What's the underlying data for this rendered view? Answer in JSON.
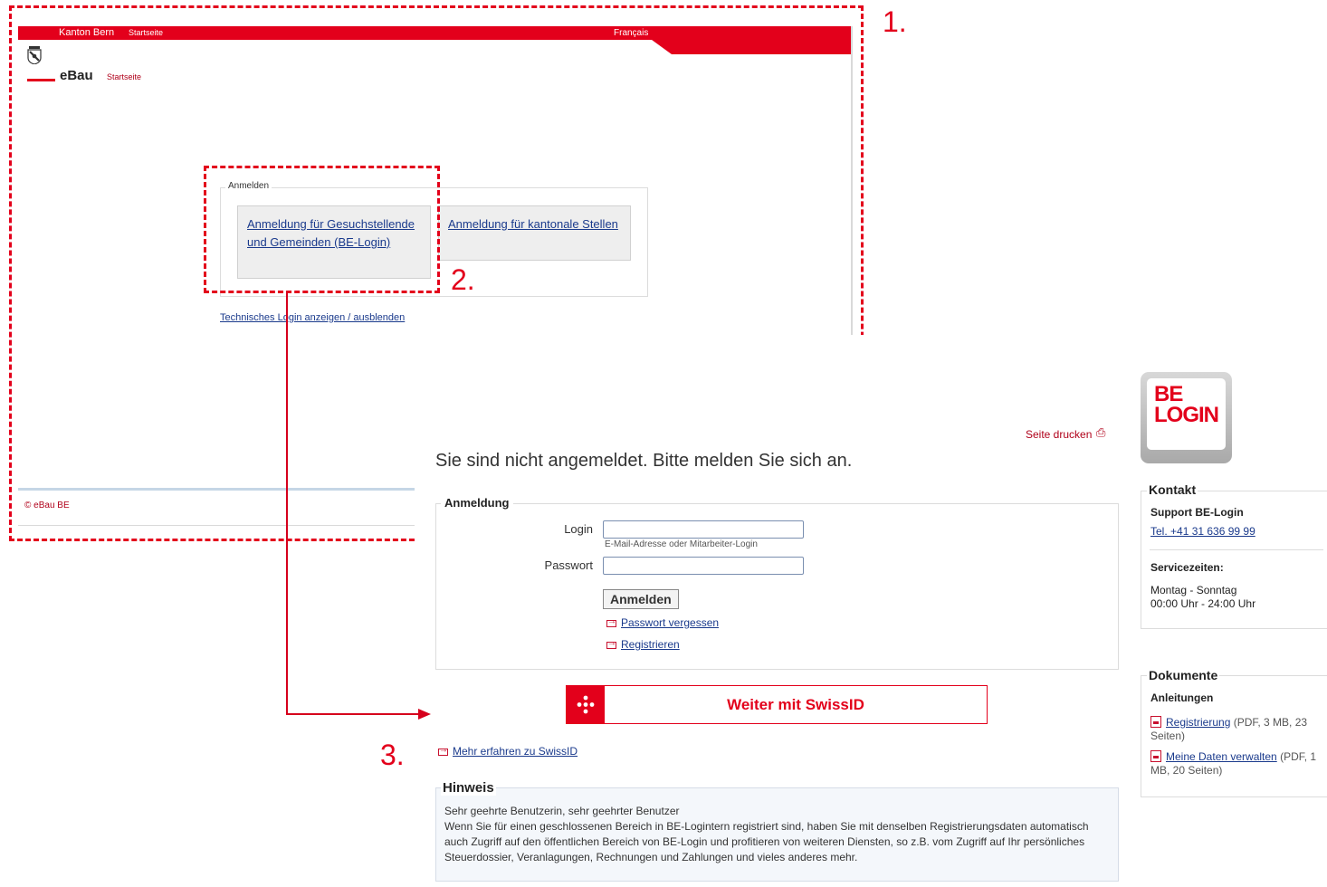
{
  "annotations": {
    "frame1_number": "1.",
    "frame2_number": "2.",
    "arrow_number": "3."
  },
  "ebau": {
    "topbar": {
      "canton": "Kanton Bern",
      "home": "Startseite",
      "language": "Français"
    },
    "app_title": "eBau",
    "app_home": "Startseite",
    "login_legend": "Anmelden",
    "choice_be_login": "Anmeldung für Gesuchstellende und Gemeinden (BE-Login)",
    "choice_kanton": "Anmeldung für kantonale Stellen",
    "tech_login": "Technisches Login anzeigen / ausblenden",
    "footer": "© eBau BE"
  },
  "belogin": {
    "print_label": "Seite drucken",
    "heading": "Sie sind nicht angemeldet. Bitte melden Sie sich an.",
    "form": {
      "legend": "Anmeldung",
      "login_label": "Login",
      "login_value": "",
      "login_hint": "E-Mail-Adresse oder Mitarbeiter-Login",
      "password_label": "Passwort",
      "password_value": "",
      "submit": "Anmelden",
      "forgot": "Passwort vergessen",
      "register": "Registrieren"
    },
    "swissid": {
      "button": "Weiter mit SwissID",
      "more": "Mehr erfahren zu SwissID"
    },
    "hint": {
      "legend": "Hinweis",
      "line1": "Sehr geehrte Benutzerin, sehr geehrter Benutzer",
      "line2": "Wenn Sie für einen geschlossenen Bereich in BE-Logintern registriert sind, haben Sie mit denselben Registrierungsdaten automatisch auch Zugriff auf den öffentlichen Bereich von BE-Login und profitieren von weiteren Diensten, so z.B. vom Zugriff auf Ihr persönliches Steuerdossier, Veranlagungen, Rechnungen und Zahlungen und vieles anderes mehr."
    },
    "logo_text_1": "BE",
    "logo_text_2": "LOGIN",
    "kontakt": {
      "legend": "Kontakt",
      "support_title": "Support BE-Login",
      "phone": "Tel. +41 31 636 99 99",
      "service_title": "Servicezeiten:",
      "service_days": "Montag - Sonntag",
      "service_hours": "00:00 Uhr - 24:00 Uhr"
    },
    "dokumente": {
      "legend": "Dokumente",
      "subtitle": "Anleitungen",
      "items": [
        {
          "link": "Registrierung",
          "info": " (PDF, 3 MB, 23 Seiten)"
        },
        {
          "link": "Meine Daten verwalten",
          "info": " (PDF, 1 MB, 20 Seiten)"
        }
      ]
    }
  }
}
